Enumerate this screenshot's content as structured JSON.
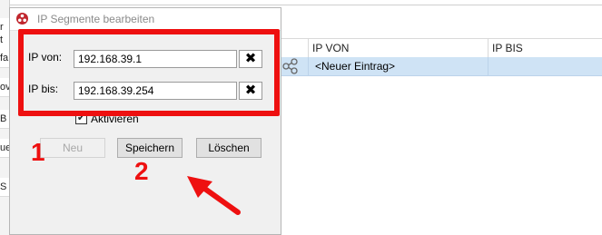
{
  "window": {
    "title": "IP Segmente bearbeiten"
  },
  "fields": {
    "ip_from": {
      "label": "IP von:",
      "value": "192.168.39.1"
    },
    "ip_to": {
      "label": "IP bis:",
      "value": "192.168.39.254"
    },
    "clear_glyph": "✖"
  },
  "activate": {
    "label": "Aktivieren",
    "checked": true
  },
  "buttons": {
    "new": "Neu",
    "save": "Speichern",
    "delete": "Löschen"
  },
  "table": {
    "columns": [
      "IP VON",
      "IP BIS"
    ],
    "rows": [
      {
        "ip_von": "<Neuer Eintrag>",
        "ip_bis": ""
      }
    ]
  },
  "annotations": {
    "num1": "1",
    "num2": "2",
    "color": "#ee1010"
  },
  "left_fragments": [
    "r",
    "t",
    "fa",
    "ov",
    "B",
    "ue",
    "S"
  ]
}
